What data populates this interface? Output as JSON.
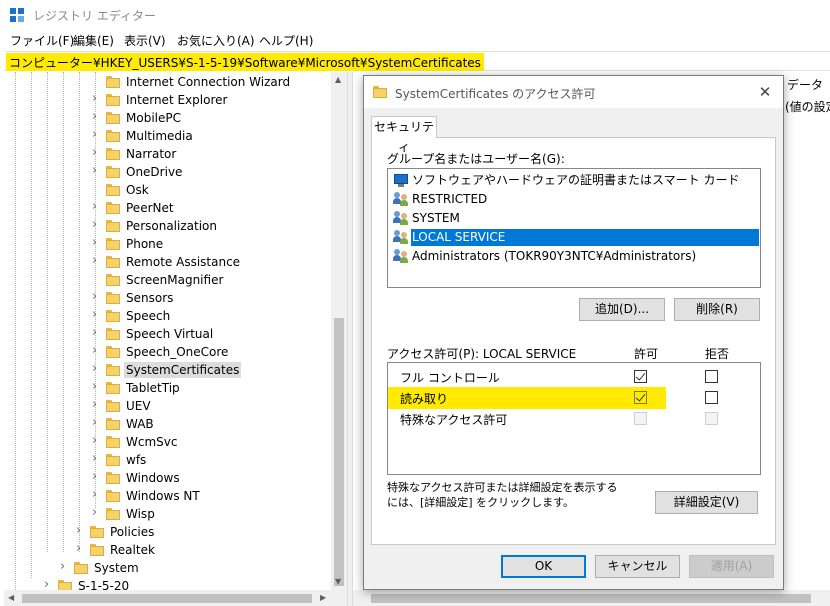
{
  "window": {
    "title": "レジストリ エディター"
  },
  "menu": [
    "ファイル(F)",
    "編集(E)",
    "表示(V)",
    "お気に入り(A)",
    "ヘルプ(H)"
  ],
  "address": "コンピューター¥HKEY_USERS¥S-1-5-19¥Software¥Microsoft¥SystemCertificates",
  "tree": {
    "items": [
      {
        "label": "Internet Connection Wizard",
        "chevron": false,
        "selected": false
      },
      {
        "label": "Internet Explorer",
        "chevron": true,
        "selected": false
      },
      {
        "label": "MobilePC",
        "chevron": true,
        "selected": false
      },
      {
        "label": "Multimedia",
        "chevron": true,
        "selected": false
      },
      {
        "label": "Narrator",
        "chevron": true,
        "selected": false
      },
      {
        "label": "OneDrive",
        "chevron": true,
        "selected": false
      },
      {
        "label": "Osk",
        "chevron": false,
        "selected": false
      },
      {
        "label": "PeerNet",
        "chevron": true,
        "selected": false
      },
      {
        "label": "Personalization",
        "chevron": true,
        "selected": false
      },
      {
        "label": "Phone",
        "chevron": true,
        "selected": false
      },
      {
        "label": "Remote Assistance",
        "chevron": true,
        "selected": false
      },
      {
        "label": "ScreenMagnifier",
        "chevron": false,
        "selected": false
      },
      {
        "label": "Sensors",
        "chevron": true,
        "selected": false
      },
      {
        "label": "Speech",
        "chevron": true,
        "selected": false
      },
      {
        "label": "Speech Virtual",
        "chevron": true,
        "selected": false
      },
      {
        "label": "Speech_OneCore",
        "chevron": true,
        "selected": false
      },
      {
        "label": "SystemCertificates",
        "chevron": true,
        "selected": true
      },
      {
        "label": "TabletTip",
        "chevron": true,
        "selected": false
      },
      {
        "label": "UEV",
        "chevron": true,
        "selected": false
      },
      {
        "label": "WAB",
        "chevron": true,
        "selected": false
      },
      {
        "label": "WcmSvc",
        "chevron": true,
        "selected": false
      },
      {
        "label": "wfs",
        "chevron": true,
        "selected": false
      },
      {
        "label": "Windows",
        "chevron": true,
        "selected": false
      },
      {
        "label": "Windows NT",
        "chevron": true,
        "selected": false
      },
      {
        "label": "Wisp",
        "chevron": true,
        "selected": false
      }
    ],
    "level2": [
      {
        "label": "Policies",
        "chevron": true
      },
      {
        "label": "Realtek",
        "chevron": true
      }
    ],
    "level1": [
      {
        "label": "System",
        "chevron": true
      },
      {
        "label": "S-1-5-20",
        "chevron": true
      }
    ]
  },
  "right_pane": {
    "header_data": "データ",
    "header_value": "(値の設定"
  },
  "dialog": {
    "title": "SystemCertificates のアクセス許可",
    "close": "✕",
    "tab": "セキュリティ",
    "group_label": "グループ名またはユーザー名(G):",
    "groups": [
      {
        "name": "ソフトウェアやハードウェアの証明書またはスマート カード",
        "icon": "pc-icon",
        "selected": false
      },
      {
        "name": "RESTRICTED",
        "icon": "users-icon",
        "selected": false
      },
      {
        "name": "SYSTEM",
        "icon": "users-icon",
        "selected": false
      },
      {
        "name": "LOCAL SERVICE",
        "icon": "users-icon",
        "selected": true
      },
      {
        "name": "Administrators (TOKR90Y3NTC¥Administrators)",
        "icon": "users-icon",
        "selected": false
      }
    ],
    "add_button": "追加(D)...",
    "remove_button": "削除(R)",
    "perm_label": "アクセス許可(P): LOCAL SERVICE",
    "allow_header": "許可",
    "deny_header": "拒否",
    "permissions": [
      {
        "name": "フル コントロール",
        "allow": true,
        "deny": false,
        "disabled": false,
        "highlight": false
      },
      {
        "name": "読み取り",
        "allow": true,
        "deny": false,
        "disabled": false,
        "highlight": true
      },
      {
        "name": "特殊なアクセス許可",
        "allow": false,
        "deny": false,
        "disabled": true,
        "highlight": false
      }
    ],
    "info_line1": "特殊なアクセス許可または詳細設定を表示する",
    "info_line2": "には、[詳細設定] をクリックします。",
    "advanced_button": "詳細設定(V)",
    "ok_button": "OK",
    "cancel_button": "キャンセル",
    "apply_button": "適用(A)"
  },
  "colors": {
    "highlight": "#ffea00",
    "selection": "#0078d7"
  }
}
